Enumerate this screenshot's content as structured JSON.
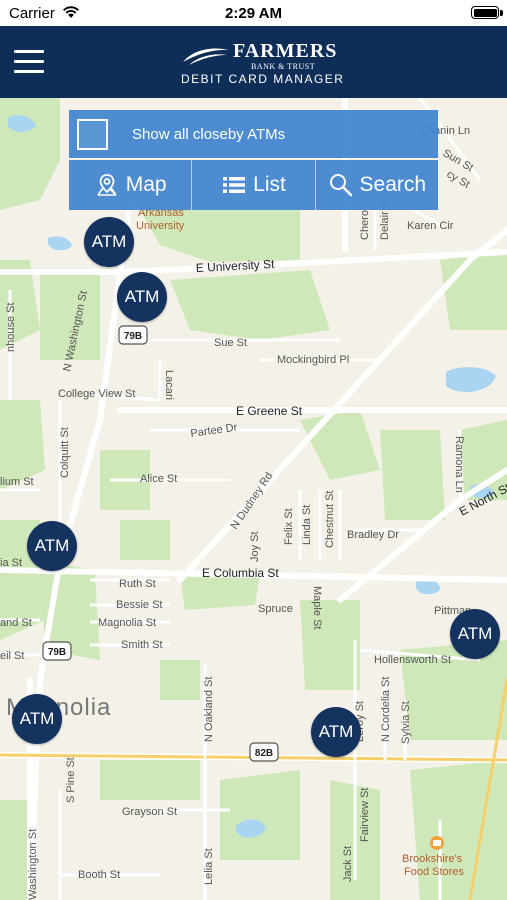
{
  "status_bar": {
    "carrier": "Carrier",
    "time": "2:29 AM"
  },
  "header": {
    "brand_name": "FARMERS",
    "brand_subtitle": "BANK & TRUST",
    "brand_tagline": "DEBIT CARD MANAGER"
  },
  "controls": {
    "show_all_label": "Show all closeby ATMs",
    "show_all_checked": false,
    "map_label": "Map",
    "list_label": "List",
    "search_label": "Search"
  },
  "map": {
    "city": "Magnolia",
    "atm_label": "ATM",
    "streets": {
      "e_university": "E University St",
      "sue": "Sue St",
      "mockingbird": "Mockingbird Pl",
      "college_view": "College View St",
      "e_greene": "E Greene St",
      "partee": "Partee Dr",
      "alice": "Alice St",
      "n_dudney": "N Dudney Rd",
      "joy": "Joy St",
      "felix": "Felix St",
      "linda": "Linda St",
      "chestnut": "Chestnut St",
      "bradley": "Bradley Dr",
      "e_north": "E North St",
      "ramona": "Ramona Ln",
      "e_columbia": "E Columbia St",
      "ruth": "Ruth St",
      "bessie": "Bessie St",
      "magnolia_st": "Magnolia St",
      "smith": "Smith St",
      "spruce": "Spruce",
      "maple": "Maple St",
      "pittman": "Pittman",
      "hollensworth": "Hollensworth St",
      "n_oakland": "N Oakland St",
      "leroy": "Leroy St",
      "n_cordelia": "N Cordelia St",
      "sylvia": "Sylvia St",
      "s_pine": "S Pine St",
      "grayson": "Grayson St",
      "fairview": "Fairview St",
      "jack": "Jack St",
      "lelia": "Lelia St",
      "booth": "Booth St",
      "washington": "Washington St",
      "n_washington": "N Washington St",
      "colquitt": "Colquitt St",
      "lacari": "Lacari",
      "karen_cir": "Karen Cir",
      "lium": "lium St",
      "ia": "ia St",
      "and": "and St",
      "eil": "eil St",
      "house": "nhouse St",
      "chanin": "Chanin Ln",
      "sun": "Sun St",
      "lacy": "cy St",
      "chero": "Chero",
      "delair": "Delair Dr"
    },
    "shields": {
      "r79b": "79B",
      "r82b": "82B"
    },
    "poi": {
      "university_line1": "Arkansas",
      "university_line2": "University",
      "store_line1": "Brookshire's",
      "store_line2": "Food Stores"
    }
  }
}
